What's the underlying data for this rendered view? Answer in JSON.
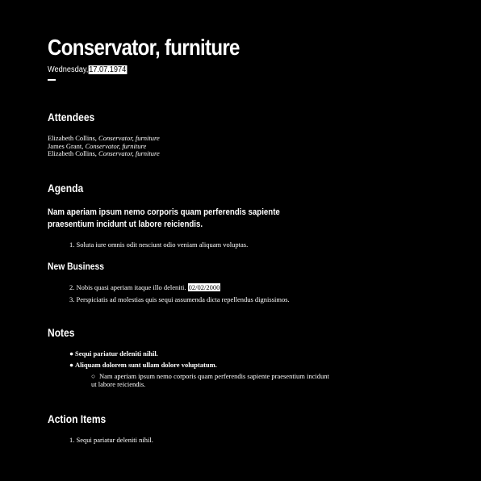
{
  "header": {
    "title": "Conservator, furniture",
    "weekday": "Wednesday,",
    "date": "17.07.1974"
  },
  "attendees": {
    "heading": "Attendees",
    "people": [
      {
        "name": "Elizabeth Collins,",
        "role": "Conservator, furniture"
      },
      {
        "name": "James Grant,",
        "role": "Conservator, furniture"
      },
      {
        "name": "Elizabeth Collins,",
        "role": "Conservator, furniture"
      }
    ]
  },
  "agenda": {
    "heading": "Agenda",
    "lead": "Nam aperiam ipsum nemo corporis quam perferendis sapiente praesentium incidunt ut labore reiciendis.",
    "items": [
      {
        "number": "1.",
        "text": "Soluta iure omnis odit nesciunt odio veniam aliquam voluptas."
      }
    ],
    "new_business": {
      "heading": "New Business",
      "items": [
        {
          "number": "2.",
          "text": "Nobis quasi aperiam itaque illo deleniti.",
          "date": "02/02/2000"
        },
        {
          "number": "3.",
          "text": "Perspiciatis ad molestias quis sequi assumenda dicta repellendus dignissimos."
        }
      ]
    }
  },
  "notes": {
    "heading": "Notes",
    "bullet_symbol": "●",
    "sub_bullet_symbol": "○",
    "items": [
      {
        "text": "Sequi pariatur deleniti nihil."
      },
      {
        "text": "Aliquam dolorem sunt ullam dolore voluptatum."
      }
    ],
    "sub_item": "Nam aperiam ipsum nemo corporis quam perferendis sapiente praesentium incidunt ut labore reiciendis."
  },
  "action_items": {
    "heading": "Action Items",
    "items": [
      {
        "number": "1.",
        "text": "Sequi pariatur deleniti nihil."
      }
    ]
  }
}
